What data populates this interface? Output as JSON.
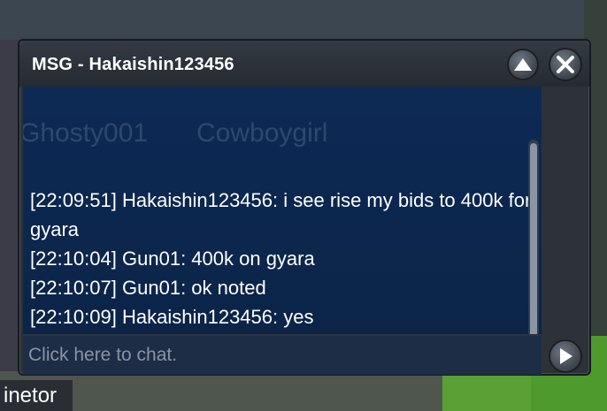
{
  "window": {
    "title": "MSG - Hakaishin123456"
  },
  "chat": {
    "messages": [
      {
        "time": "[22:09:51]",
        "sender": "Hakaishin123456",
        "text": "i see rise my bids to 400k for gyara"
      },
      {
        "time": "[22:10:04]",
        "sender": "Gun01",
        "text": "400k on gyara"
      },
      {
        "time": "[22:10:07]",
        "sender": "Gun01",
        "text": "ok noted"
      },
      {
        "time": "[22:10:09]",
        "sender": "Hakaishin123456",
        "text": "yes"
      }
    ],
    "placeholder": "Click here to chat."
  },
  "background": {
    "names": [
      "Ghosty001",
      "Cowboygirl"
    ],
    "bottom_label": "inetor"
  },
  "icons": {
    "minimize": "chevron-up-icon",
    "close": "close-icon",
    "send": "arrow-right-icon"
  },
  "colors": {
    "chat_bg": "#0d2a55",
    "window_frame": "#2d3239",
    "text": "#ffffff",
    "placeholder": "#8894a4"
  }
}
